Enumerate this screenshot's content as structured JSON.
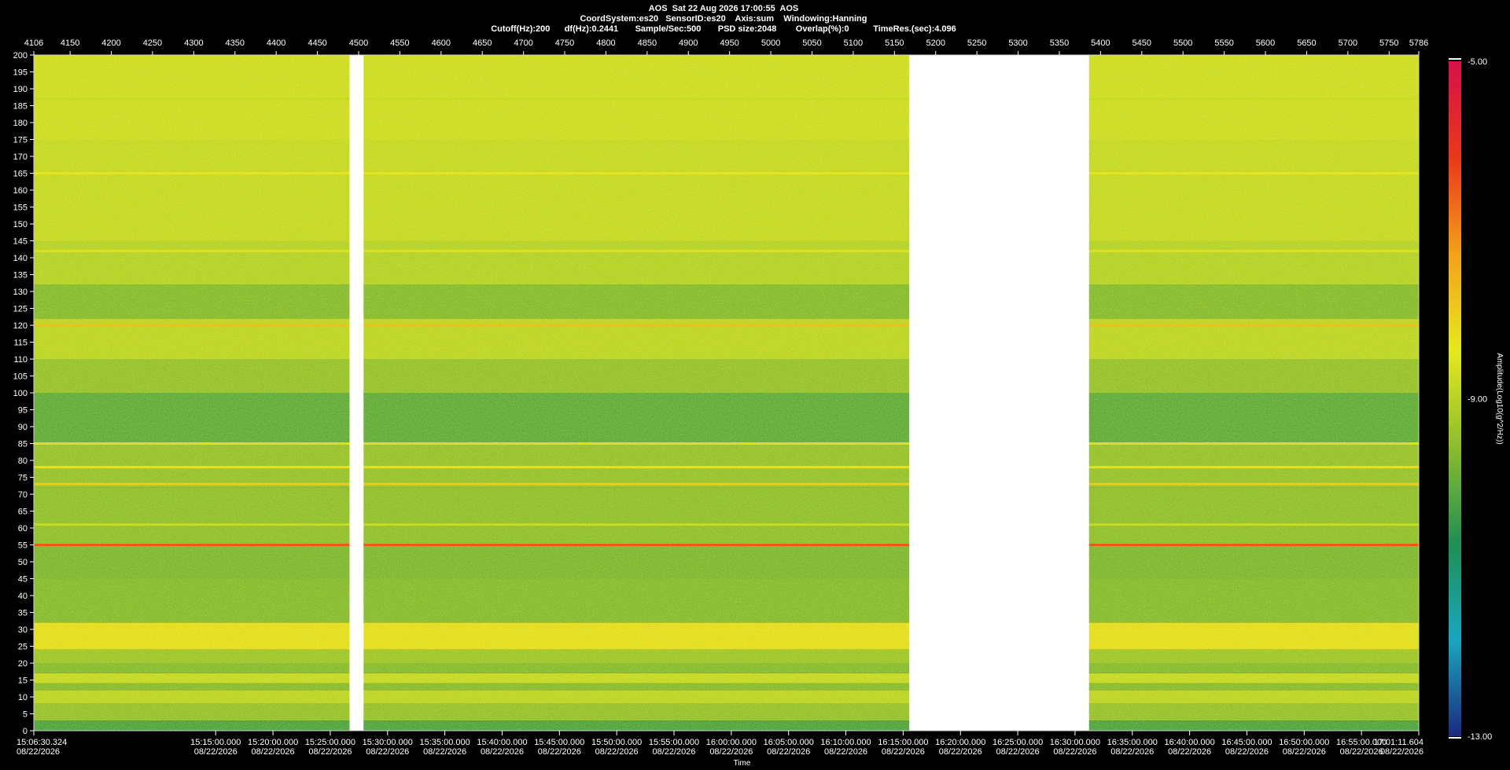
{
  "header": {
    "title": "AOS  Sat 22 Aug 2026 17:00:55  AOS",
    "line2": "CoordSystem:es20   SensorID:es20    Axis:sum    Windowing:Hanning",
    "line3": "Cutoff(Hz):200      df(Hz):0.2441       Sample/Sec:500       PSD size:2048        Overlap(%):0          TimeRes.(sec):4.096"
  },
  "chart_data": {
    "type": "heatmap",
    "subtype": "spectrogram",
    "top_axis": {
      "min": 4106,
      "max": 5786,
      "ticks": [
        4106,
        4150,
        4200,
        4250,
        4300,
        4350,
        4400,
        4450,
        4500,
        4550,
        4600,
        4650,
        4700,
        4750,
        4800,
        4850,
        4900,
        4950,
        5000,
        5050,
        5100,
        5150,
        5200,
        5250,
        5300,
        5350,
        5400,
        5450,
        5500,
        5550,
        5600,
        5650,
        5700,
        5750,
        5786
      ]
    },
    "y_axis": {
      "min": 0,
      "max": 200,
      "step": 5
    },
    "x_axis": {
      "label": "Time",
      "tick_labels": [
        [
          "15:06:30.324",
          "08/22/2026"
        ],
        [
          "15:15:00.000",
          "08/22/2026"
        ],
        [
          "15:20:00.000",
          "08/22/2026"
        ],
        [
          "15:25:00.000",
          "08/22/2026"
        ],
        [
          "15:30:00.000",
          "08/22/2026"
        ],
        [
          "15:35:00.000",
          "08/22/2026"
        ],
        [
          "15:40:00.000",
          "08/22/2026"
        ],
        [
          "15:45:00.000",
          "08/22/2026"
        ],
        [
          "15:50:00.000",
          "08/22/2026"
        ],
        [
          "15:55:00.000",
          "08/22/2026"
        ],
        [
          "16:00:00.000",
          "08/22/2026"
        ],
        [
          "16:05:00.000",
          "08/22/2026"
        ],
        [
          "16:10:00.000",
          "08/22/2026"
        ],
        [
          "16:15:00.000",
          "08/22/2026"
        ],
        [
          "16:20:00.000",
          "08/22/2026"
        ],
        [
          "16:25:00.000",
          "08/22/2026"
        ],
        [
          "16:30:00.000",
          "08/22/2026"
        ],
        [
          "16:35:00.000",
          "08/22/2026"
        ],
        [
          "16:40:00.000",
          "08/22/2026"
        ],
        [
          "16:45:00.000",
          "08/22/2026"
        ],
        [
          "16:50:00.000",
          "08/22/2026"
        ],
        [
          "16:55:00.000",
          "08/22/2026"
        ],
        [
          "17:01:11.604",
          "08/22/2026"
        ]
      ]
    },
    "colorbar": {
      "label": "Amplitude(Log10(g^2/Hz))",
      "min": -13.0,
      "max": -5.0,
      "tick_labels": [
        "-5.00",
        "-9.00",
        "-13.00"
      ],
      "colors": [
        "#1a2a80",
        "#1aa6c0",
        "#1f8f52",
        "#8cbd2d",
        "#e6e81e",
        "#f5a01a",
        "#e8381a",
        "#d6104a"
      ]
    },
    "data_gaps_top_axis": [
      [
        4489,
        4506
      ],
      [
        5168,
        5386
      ]
    ],
    "harmonic_lines_hz": [
      {
        "hz": 55,
        "level": -6.5
      },
      {
        "hz": 73,
        "level": -8.0
      },
      {
        "hz": 78,
        "level": -8.3
      },
      {
        "hz": 85,
        "level": -8.6
      },
      {
        "hz": 61,
        "level": -8.8
      },
      {
        "hz": 120,
        "level": -7.8
      },
      {
        "hz": 165,
        "level": -8.4
      },
      {
        "hz": 142,
        "level": -8.6
      },
      {
        "hz": 187,
        "level": -8.8
      }
    ]
  }
}
